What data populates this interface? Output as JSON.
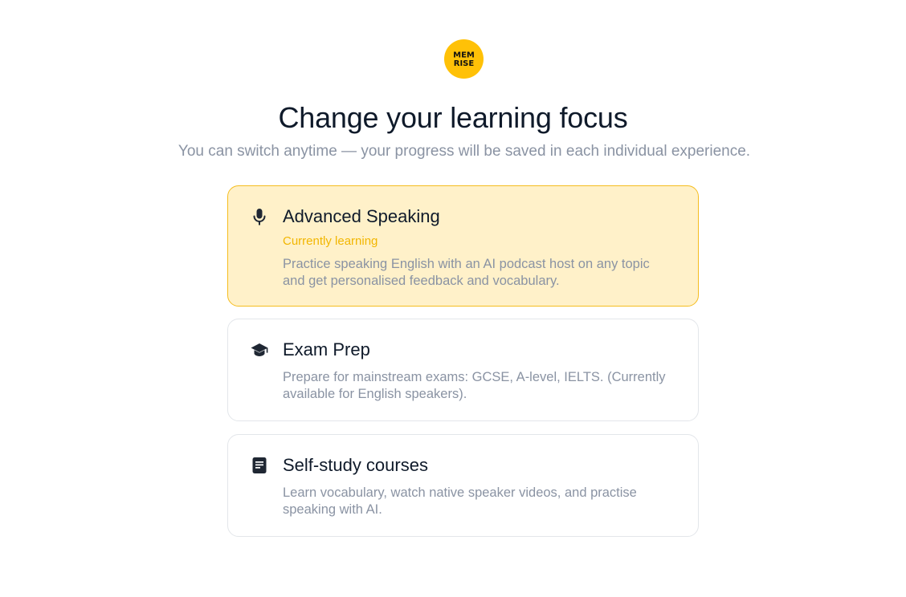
{
  "logo": {
    "line1": "MEM",
    "line2": "RISE",
    "bg_color": "#FFC107"
  },
  "header": {
    "title": "Change your learning focus",
    "subtitle": "You can switch anytime — your progress will be saved in each individual experience."
  },
  "options": [
    {
      "icon": "microphone-icon",
      "title": "Advanced Speaking",
      "status": "Currently learning",
      "description": "Practice speaking English with an AI podcast host on any topic and get personalised feedback and vocabulary.",
      "selected": true
    },
    {
      "icon": "graduation-cap-icon",
      "title": "Exam Prep",
      "description": "Prepare for mainstream exams: GCSE, A-level, IELTS. (Currently available for English speakers).",
      "selected": false
    },
    {
      "icon": "document-icon",
      "title": "Self-study courses",
      "description": "Learn vocabulary, watch native speaker videos, and practise speaking with AI.",
      "selected": false
    }
  ],
  "colors": {
    "accent": "#FFC107",
    "selected_bg": "#FFF1C9",
    "selected_border": "#F5BD1F",
    "status_text": "#F2B600",
    "title_text": "#0f1a2a",
    "muted_text": "#8a93a3"
  }
}
